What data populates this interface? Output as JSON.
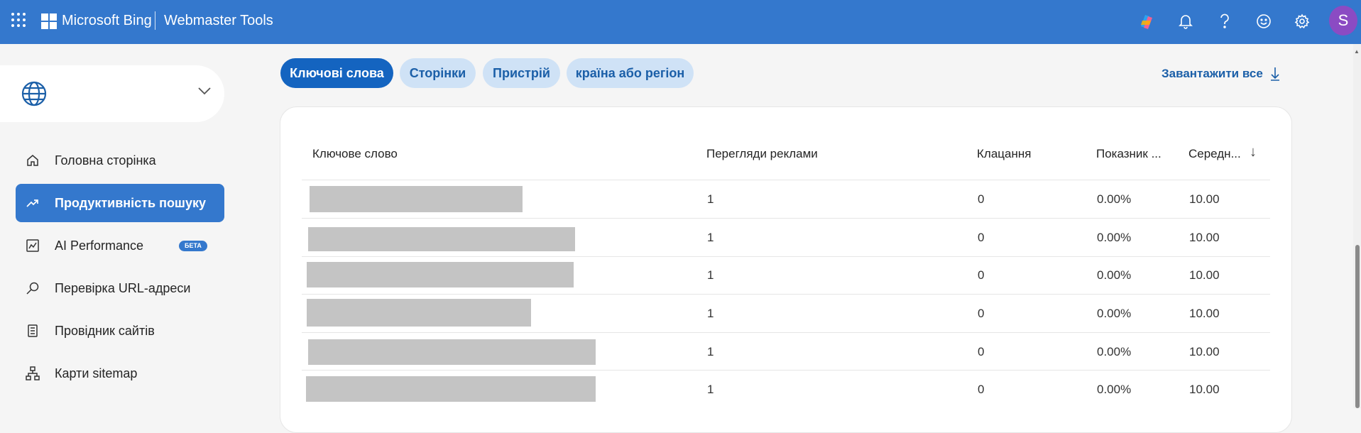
{
  "header": {
    "brand": "Microsoft Bing",
    "product": "Webmaster Tools",
    "avatar_initial": "S",
    "icons": [
      "copilot-icon",
      "bell-icon",
      "help-icon",
      "feedback-smiley-icon",
      "gear-icon"
    ],
    "color": "#3478cd"
  },
  "sidebar": {
    "site_selector": {
      "icon": "globe-icon",
      "value": ""
    },
    "items": [
      {
        "label": "Головна сторінка",
        "icon": "home-icon",
        "active": false
      },
      {
        "label": "Продуктивність пошуку",
        "icon": "trend-icon",
        "active": true
      },
      {
        "label": "AI Performance",
        "icon": "ai-chart-icon",
        "active": false,
        "badge": "БЕТА"
      },
      {
        "label": "Перевірка URL-адреси",
        "icon": "search-icon",
        "active": false
      },
      {
        "label": "Провідник сайтів",
        "icon": "site-explorer-icon",
        "active": false
      },
      {
        "label": "Карти sitemap",
        "icon": "sitemap-icon",
        "active": false
      }
    ]
  },
  "tabs": [
    {
      "label": "Ключові слова",
      "active": true
    },
    {
      "label": "Сторінки",
      "active": false
    },
    {
      "label": "Пристрій",
      "active": false
    },
    {
      "label": "країна або регіон",
      "active": false
    }
  ],
  "download": {
    "label": "Завантажити все",
    "icon": "download-icon"
  },
  "table": {
    "columns": [
      "Ключове слово",
      "Перегляди реклами",
      "Клацання",
      "Показник ...",
      "Середн...",
      "↓"
    ],
    "sort_icon": "arrow-down-icon",
    "rows": [
      {
        "keyword": "",
        "impressions": "1",
        "clicks": "0",
        "ctr": "0.00%",
        "avg": "10.00"
      },
      {
        "keyword": "",
        "impressions": "1",
        "clicks": "0",
        "ctr": "0.00%",
        "avg": "10.00"
      },
      {
        "keyword": "",
        "impressions": "1",
        "clicks": "0",
        "ctr": "0.00%",
        "avg": "10.00"
      },
      {
        "keyword": "",
        "impressions": "1",
        "clicks": "0",
        "ctr": "0.00%",
        "avg": "10.00"
      },
      {
        "keyword": "",
        "impressions": "1",
        "clicks": "0",
        "ctr": "0.00%",
        "avg": "10.00"
      },
      {
        "keyword": "",
        "impressions": "1",
        "clicks": "0",
        "ctr": "0.00%",
        "avg": "10.00"
      }
    ]
  }
}
